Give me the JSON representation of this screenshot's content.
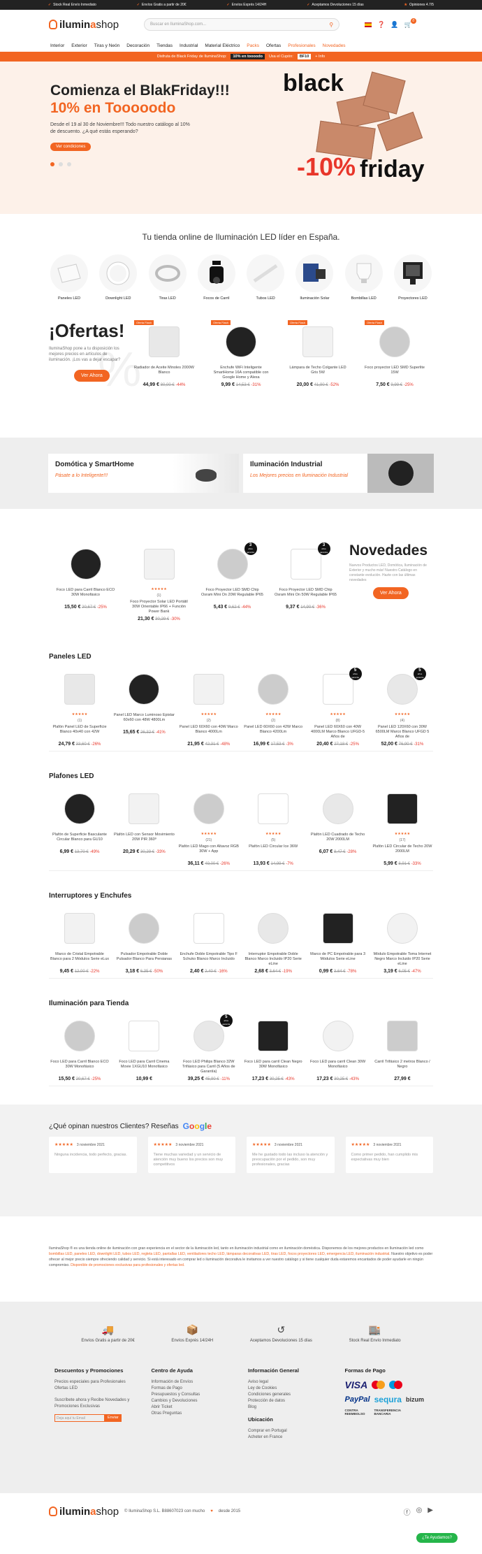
{
  "topbar": [
    "Stock Real Envío Inmediato",
    "Envíos Gratis a partir de 20€",
    "Envíos Exprés 14/24H",
    "Aceptamos Devoluciones 15 días",
    "Opiniones 4.7/5"
  ],
  "header": {
    "logo_a": "ilumin",
    "logo_b": "a",
    "logo_c": "shop",
    "search_placeholder": "Buscar en IluminaShop.com...",
    "cart_count": "0"
  },
  "nav": [
    "Interior",
    "Exterior",
    "Tiras y Neón",
    "Decoración",
    "Tiendas",
    "Industrial",
    "Material Eléctrico",
    "Packs",
    "Ofertas",
    "Profesionales",
    "Novedades"
  ],
  "promo": {
    "text1": "Disfruta de Black Friday de IluminaShop:",
    "code1": "10% en toooodo",
    "text2": "Usa el Cupón:",
    "code2": "BF10",
    "link": "+ Info"
  },
  "hero": {
    "title": "Comienza el BlakFriday!!!",
    "subtitle": "10% en Tooooodo",
    "body": "Desde el 19 al 30 de Noviembre!!! Todo nuestro catálogo al 10% de descuento. ¿A qué estás esperando?",
    "cta": "Ver condiciones",
    "art1": "black",
    "art2": "-10%",
    "art3": "friday"
  },
  "tagline": "Tu tienda online de Iluminación LED líder en España.",
  "categories": [
    "Paneles LED",
    "Downlight LED",
    "Tiras LED",
    "Focos de Carril",
    "Tubos LED",
    "Iluminación Solar",
    "Bombillas LED",
    "Proyectores LED"
  ],
  "ofertas": {
    "title": "¡Ofertas!",
    "body": "IluminaShop pone a tu disposición los mejores precios en artículos de iluminación. ¡Los vas a dejar escapar?",
    "cta": "Ver Ahora",
    "tag": "Oferta Flash",
    "items": [
      {
        "name": "Radiador de Aceite Minoles 2000W Blanco",
        "price": "44,99 €",
        "old": "80,00 €",
        "disc": "-44%"
      },
      {
        "name": "Enchufe WiFi Inteligente SmartHome 16A compatible con Google Home y Alexa",
        "price": "9,99 €",
        "old": "14,53 €",
        "disc": "-31%"
      },
      {
        "name": "Lámpara de Techo Colgante LED Gris 5W",
        "price": "20,00 €",
        "old": "41,90 €",
        "disc": "-52%"
      },
      {
        "name": "Foco proyector LED SMD Superlite 15W",
        "price": "7,50 €",
        "old": "9,99 €",
        "disc": "-25%"
      }
    ]
  },
  "banners": [
    {
      "title": "Domótica y SmartHome",
      "sub": "Pásate a lo Inteligente!!!"
    },
    {
      "title": "Iluminación Industrial",
      "sub": "Los Mejores precios en Iluminación Industrial"
    }
  ],
  "novedades": {
    "title": "Novedades",
    "body": "Nuevos Productos LED, Domótica, Iluminación de Exterior y mucho más! Nuestro Catálogo en constante evolución. Hazte con las últimas novedades",
    "cta": "Ver Ahora",
    "items": [
      {
        "name": "Foco LED para Carril Blanco ECO 30W Monofásico",
        "price": "15,50 €",
        "old": "20,67 €",
        "disc": "-25%",
        "stars": "",
        "badge": ""
      },
      {
        "name": "Foco Proyector Solar LED Portátil 30W Orientable IP66 + Función Power Bank",
        "price": "21,30 €",
        "old": "30,29 €",
        "disc": "-30%",
        "stars": "★★★★★",
        "rc": "(1)",
        "badge": ""
      },
      {
        "name": "Foco Proyector LED SMD Chip Osram Mini On 20W Regulable IP65",
        "price": "5,43 €",
        "old": "9,62 €",
        "disc": "-44%",
        "stars": "",
        "badge": "3"
      },
      {
        "name": "Foco Proyector LED SMD Chip Osram Mini On 50W Regulable IP65",
        "price": "9,37 €",
        "old": "14,90 €",
        "disc": "-36%",
        "stars": "",
        "badge": "3"
      }
    ]
  },
  "badge_text": "años garantía",
  "sections": [
    {
      "title": "Paneles LED",
      "items": [
        {
          "name": "Plafón Panel LED de Superficie Blanco 40x40 con 42W",
          "price": "24,79 €",
          "old": "33,60 €",
          "disc": "-26%",
          "stars": "★★★★★",
          "rc": "(1)",
          "badge": ""
        },
        {
          "name": "Panel LED Marco Luminoso Epistar 60x60 con 48W 4800Lm",
          "price": "15,65 €",
          "old": "26,32 €",
          "disc": "-41%",
          "stars": "",
          "badge": ""
        },
        {
          "name": "Panel LED 60X60 con 40W Marco Blanco 4000Lm",
          "price": "21,95 €",
          "old": "42,31 €",
          "disc": "-48%",
          "stars": "★★★★★",
          "rc": "(2)",
          "badge": ""
        },
        {
          "name": "Panel LED 60X60 con 42W Marco Blanco 4200Lm",
          "price": "16,99 €",
          "old": "17,53 €",
          "disc": "-3%",
          "stars": "★★★★★",
          "rc": "(2)",
          "badge": ""
        },
        {
          "name": "Panel LED 60X60 con 40W 4000LM Marco Blanco UFGD-5 Años de",
          "price": "20,40 €",
          "old": "27,18 €",
          "disc": "-25%",
          "stars": "★★★★★",
          "rc": "(8)",
          "badge": "5"
        },
        {
          "name": "Panel LED 120X60 con 30W 6500LM Marco Blanco UFGD 5 Años de",
          "price": "52,00 €",
          "old": "76,90 €",
          "disc": "-31%",
          "stars": "★★★★★",
          "rc": "(4)",
          "badge": "5"
        }
      ]
    },
    {
      "title": "Plafones LED",
      "items": [
        {
          "name": "Plafón de Superficie Basculante Circular Blanco para GU10",
          "price": "6,99 €",
          "old": "13,70 €",
          "disc": "-49%",
          "stars": "",
          "badge": ""
        },
        {
          "name": "Plafón LED con Sensor Movimiento 20W PIR 360º",
          "price": "20,29 €",
          "old": "30,29 €",
          "disc": "-33%",
          "stars": "",
          "badge": ""
        },
        {
          "name": "Plafón LED Mago con Altavoz RGB 30W + App",
          "price": "36,11 €",
          "old": "49,00 €",
          "disc": "-26%",
          "stars": "★★★★★",
          "rc": "(21)",
          "badge": ""
        },
        {
          "name": "Plafón LED Circular Ice 36W",
          "price": "13,93 €",
          "old": "14,99 €",
          "disc": "-7%",
          "stars": "★★★★★",
          "rc": "(5)",
          "badge": ""
        },
        {
          "name": "Plafón LED Cuadrado de Techo 20W 2000LM",
          "price": "6,07 €",
          "old": "8,47 €",
          "disc": "-28%",
          "stars": "",
          "badge": ""
        },
        {
          "name": "Plafón LED Circular de Techo 20W 2000LM",
          "price": "5,99 €",
          "old": "8,91 €",
          "disc": "-33%",
          "stars": "★★★★★",
          "rc": "(17)",
          "badge": ""
        }
      ]
    },
    {
      "title": "Interruptores y Enchufes",
      "items": [
        {
          "name": "Marco de Cristal Empotrable Blanco para 2 Módulos Serie eLux",
          "price": "9,45 €",
          "old": "12,00 €",
          "disc": "-22%",
          "stars": "",
          "badge": ""
        },
        {
          "name": "Pulsador Empotrable Doble Pulsador Blanco Para Persianas",
          "price": "3,18 €",
          "old": "6,35 €",
          "disc": "-50%",
          "stars": "",
          "badge": ""
        },
        {
          "name": "Enchufe Doble Empotrable Tipo F Schuko Blanco Marco Incluido",
          "price": "2,40 €",
          "old": "2,40 €",
          "disc": "-16%",
          "stars": "",
          "badge": ""
        },
        {
          "name": "Interruptor Empotrable Doble Blanco Marco Incluido IP20 Serie eLine",
          "price": "2,68 €",
          "old": "3,64 €",
          "disc": "-19%",
          "stars": "",
          "badge": ""
        },
        {
          "name": "Marco de PC Empotrable para 3 Módulos Serie eLine",
          "price": "0,99 €",
          "old": "3,64 €",
          "disc": "-78%",
          "stars": "",
          "badge": ""
        },
        {
          "name": "Módulo Empotrable Toma Internet Negro Marco Incluido IP20 Serie eLine",
          "price": "3,19 €",
          "old": "6,05 €",
          "disc": "-47%",
          "stars": "",
          "badge": ""
        }
      ]
    },
    {
      "title": "Iluminación para Tienda",
      "items": [
        {
          "name": "Foco LED para Carril Blanco ECO 30W Monofásico",
          "price": "15,50 €",
          "old": "20,67 €",
          "disc": "-25%",
          "stars": "",
          "badge": ""
        },
        {
          "name": "Foco LED para Carril Cinema Movie 1XGU10 Monofásico",
          "price": "10,99 €",
          "old": "",
          "disc": "",
          "stars": "",
          "badge": ""
        },
        {
          "name": "Foco LED Philips Blanco 32W Trifásico para Carril (5 Años de Garantía)",
          "price": "39,25 €",
          "old": "45,90 €",
          "disc": "-11%",
          "stars": "",
          "badge": "5"
        },
        {
          "name": "Foco LED para carril Clean Negro 30W Monofásico",
          "price": "17,23 €",
          "old": "30,25 €",
          "disc": "-43%",
          "stars": "",
          "badge": ""
        },
        {
          "name": "Foco LED para carril Clean 30W Monofásico",
          "price": "17,23 €",
          "old": "30,25 €",
          "disc": "-43%",
          "stars": "",
          "badge": ""
        },
        {
          "name": "Carril Trifásico 2 metros Blanco / Negro",
          "price": "27,99 €",
          "old": "",
          "disc": "",
          "stars": "",
          "badge": ""
        }
      ]
    }
  ],
  "reviews": {
    "title": "¿Qué opinan nuestros Clientes? Reseñas",
    "brand": "Google",
    "items": [
      {
        "date": "3 noviembre 2021",
        "text": "Ninguna incidencia, todo perfecto, gracias."
      },
      {
        "date": "3 noviembre 2021",
        "text": "Tiene muchas variedad y un servicio de atención muy bueno los precios son muy competitivos"
      },
      {
        "date": "3 noviembre 2021",
        "text": "Me he gustado todo las incluso la atención y preocupación por el pedido, son muy profesionales, gracias"
      },
      {
        "date": "3 noviembre 2021",
        "text": "Como primer pedido, han cumplido mis expectativas muy bien"
      }
    ]
  },
  "seo": {
    "a": "IluminaShop ® es una tienda online de iluminación con gran experiencia en el sector de la iluminación led, tanto en iluminación industrial como en iluminación doméstica. Disponemos de los mejores productos en Iluminación led como ",
    "b": "bombillas LED, paneles LED, downlight LED, tubos LED, regleta LED, pantallas LED, ventiladores techo LED, lámparas decorativas LED, tiras LED, focos proyectores LED, emergencia LED, iluminación industrial.",
    "c": " Nuestro objetivo es poder ofrecer al mejor precio siempre ofreciendo calidad y servicio. Si está interesado en comprar led o iluminación decorativa le invitamos a ver nuestro catálogo y si tiene cualquier duda estaremos encantados de poder ayudarle en ningún compromiso. ",
    "d": "Disponible de promociones exclusivas para profesionales y ofertas led."
  },
  "features": [
    "Envíos Gratis a partir de 20€",
    "Envíos Exprés 14/24H",
    "Aceptamos Devoluciones 15 días",
    "Stock Real Envío Inmediato"
  ],
  "footer": {
    "col1": {
      "title": "Descuentos y Promociones",
      "links": [
        "Precios especiales para Profesionales",
        "Ofertas LED"
      ],
      "news": "Suscríbete ahora y Recibe Novedades y Promociones Exclusivas",
      "placeholder": "Deja aquí tu Email",
      "btn": "Enviar"
    },
    "col2": {
      "title": "Centro de Ayuda",
      "links": [
        "Información de Envíos",
        "Formas de Pago",
        "Presupuestos y Consultas",
        "Cambios y Devoluciones",
        "Abrir Ticket",
        "Otras Preguntas"
      ]
    },
    "col3": {
      "title": "Información General",
      "links": [
        "Aviso legal",
        "Ley de Cookies",
        "Condiciones generales",
        "Protección de datos",
        "Blog"
      ],
      "title2": "Ubicación",
      "loc": [
        "Comprar en Portugal",
        "Acheter en France"
      ]
    },
    "col4": {
      "title": "Formas de Pago",
      "pay": [
        "VISA",
        "Mastercard",
        "Maestro",
        "PayPal",
        "sequra",
        "bizum",
        "CONTRA REEMBOLSO",
        "TRANSFERENCIA BANCARIA"
      ]
    }
  },
  "bottom": {
    "copy": "© IluminaShop S.L. B88607023 con mucho",
    "heart": "♥",
    "year": "desde 2015",
    "help": "¿Te Ayudamos?"
  }
}
